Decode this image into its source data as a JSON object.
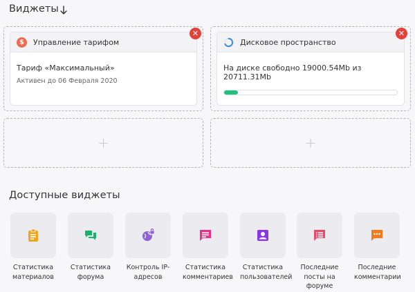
{
  "header": {
    "title": "Виджеты"
  },
  "widgets": {
    "tariff": {
      "title": "Управление тарифом",
      "line1": "Тариф «Максимальный»",
      "line2": "Активен до 06 Февраля 2020"
    },
    "disk": {
      "title": "Дисковое пространство",
      "line1": "На диске свободно 19000.54Mb из 20711.31Mb",
      "usage_fraction": 0.08
    }
  },
  "empty_slot_symbol": "+",
  "close_symbol": "✕",
  "available": {
    "title": "Доступные виджеты",
    "items": [
      {
        "label": "Статистика материалов",
        "icon": "clipboard-icon",
        "color": "#f2a51b"
      },
      {
        "label": "Статистика форума",
        "icon": "forum-icon",
        "color": "#18b36b"
      },
      {
        "label": "Контроль IP-адресов",
        "icon": "globe-lock-icon",
        "color": "#8e62d6"
      },
      {
        "label": "Статистика комментариев",
        "icon": "comment-icon",
        "color": "#e9318c"
      },
      {
        "label": "Статистика пользователей",
        "icon": "user-icon",
        "color": "#8a35e6"
      },
      {
        "label": "Последние посты на форуме",
        "icon": "post-list-icon",
        "color": "#e84a6a"
      },
      {
        "label": "Последние комментарии",
        "icon": "comment-dots-icon",
        "color": "#f07a1d"
      }
    ]
  }
}
